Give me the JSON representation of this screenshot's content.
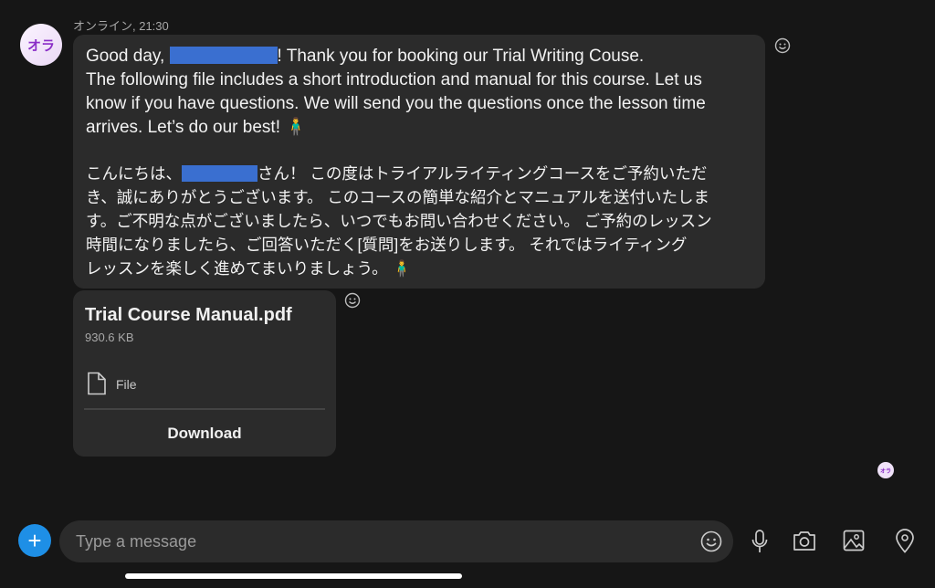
{
  "contact": {
    "avatar_text": "オラ",
    "status": "オンライン, 21:30"
  },
  "message": {
    "en_lines": [
      {
        "before": "Good day, ",
        "after": "! Thank you for booking our Trial Writing Couse."
      },
      "The following file includes a short introduction and manual for this course. Let us",
      "know if you have questions. We will send you the questions once the lesson time",
      "arrives. Let’s do our best! 🧍‍♂️"
    ],
    "jp_lines": [
      {
        "before": "こんにちは、",
        "after": "さん！ この度はトライアルライティングコースをご予約いただ"
      },
      "き、誠にありがとうございます。 このコースの簡単な紹介とマニュアルを送付いたしま",
      "す。ご不明な点がございましたら、いつでもお問い合わせください。 ご予約のレッスン",
      "時間になりましたら、ご回答いただく[質問]をお送りします。 それではライティング",
      "レッスンを楽しく進めてまいりましょう。 🧍‍♂️"
    ]
  },
  "attachment": {
    "name": "Trial Course Manual.pdf",
    "size": "930.6 KB",
    "type": "File",
    "download_label": "Download"
  },
  "read_receipt": {
    "avatar_text": "オラ"
  },
  "composer": {
    "placeholder": "Type a message",
    "plus": "+"
  },
  "colors": {
    "accent": "#1e8fe6",
    "bubble": "#2b2b2b",
    "background": "#161616",
    "redaction": "#3a6fd0"
  }
}
